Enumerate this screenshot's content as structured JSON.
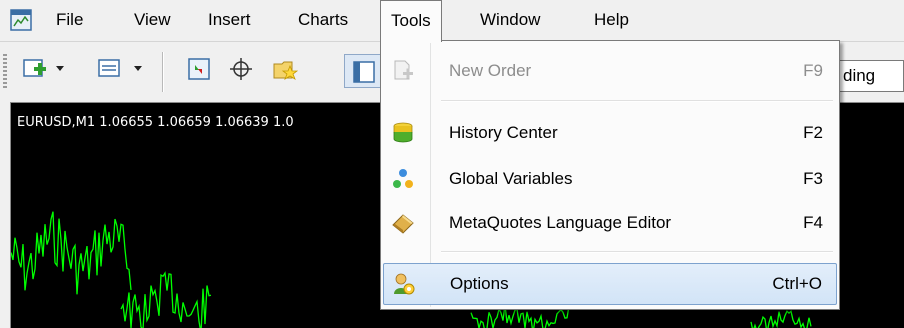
{
  "menubar": {
    "items": [
      {
        "label": "File"
      },
      {
        "label": "View"
      },
      {
        "label": "Insert"
      },
      {
        "label": "Charts"
      },
      {
        "label": "Tools"
      },
      {
        "label": "Window"
      },
      {
        "label": "Help"
      }
    ],
    "open_menu": "Tools"
  },
  "toolbar": {
    "buttons": [
      {
        "icon": "new-chart-icon"
      },
      {
        "icon": "profiles-icon"
      },
      {
        "icon": "market-watch-icon"
      },
      {
        "icon": "crosshair-icon"
      },
      {
        "icon": "navigator-icon"
      },
      {
        "icon": "terminal-icon"
      }
    ],
    "trading_label": "ding"
  },
  "chart": {
    "header": "EURUSD,M1  1.06655 1.06659 1.06639 1.0",
    "background": "#000000",
    "line_color": "#00ff00"
  },
  "tools_menu": {
    "items": [
      {
        "label": "New Order",
        "shortcut": "F9",
        "icon": "new-order-icon",
        "disabled": true
      },
      {
        "label": "History Center",
        "shortcut": "F2",
        "icon": "history-center-icon",
        "disabled": false
      },
      {
        "label": "Global Variables",
        "shortcut": "F3",
        "icon": "global-variables-icon",
        "disabled": false
      },
      {
        "label": "MetaQuotes Language Editor",
        "shortcut": "F4",
        "icon": "metaeditor-icon",
        "disabled": false
      },
      {
        "label": "Options",
        "shortcut": "Ctrl+O",
        "icon": "options-icon",
        "disabled": false,
        "highlighted": true
      }
    ]
  },
  "colors": {
    "menu_highlight": "#d2e4f7",
    "menu_highlight_border": "#7da2ce",
    "disabled_text": "#8d8d8d"
  }
}
